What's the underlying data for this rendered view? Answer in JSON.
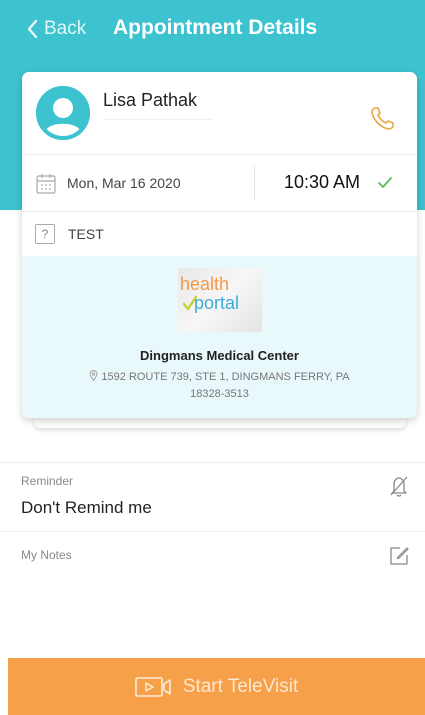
{
  "header": {
    "back_label": "Back",
    "title": "Appointment Details"
  },
  "patient": {
    "name": "Lisa Pathak"
  },
  "appointment": {
    "date": "Mon, Mar 16 2020",
    "time": "10:30 AM",
    "type": "TEST"
  },
  "provider": {
    "logo_text_top": "health",
    "logo_text_bottom": "portal",
    "facility_name": "Dingmans Medical Center",
    "address_line1": "1592 ROUTE 739, STE 1, DINGMANS FERRY, PA",
    "address_line2": "18328-3513"
  },
  "reminder": {
    "label": "Reminder",
    "value": "Don't Remind me"
  },
  "notes": {
    "label": "My Notes"
  },
  "cta": {
    "label": "Start TeleVisit"
  },
  "colors": {
    "header_bg": "#3cc3cf",
    "cta_bg": "#f7a04a",
    "phone_icon": "#e9a640",
    "check": "#5cb85c",
    "provider_bg": "#e9f8fa"
  },
  "icons": [
    "chevron-left-icon",
    "avatar-icon",
    "phone-icon",
    "calendar-icon",
    "checkmark-icon",
    "question-icon",
    "location-pin-icon",
    "bell-off-icon",
    "edit-icon",
    "video-icon"
  ]
}
